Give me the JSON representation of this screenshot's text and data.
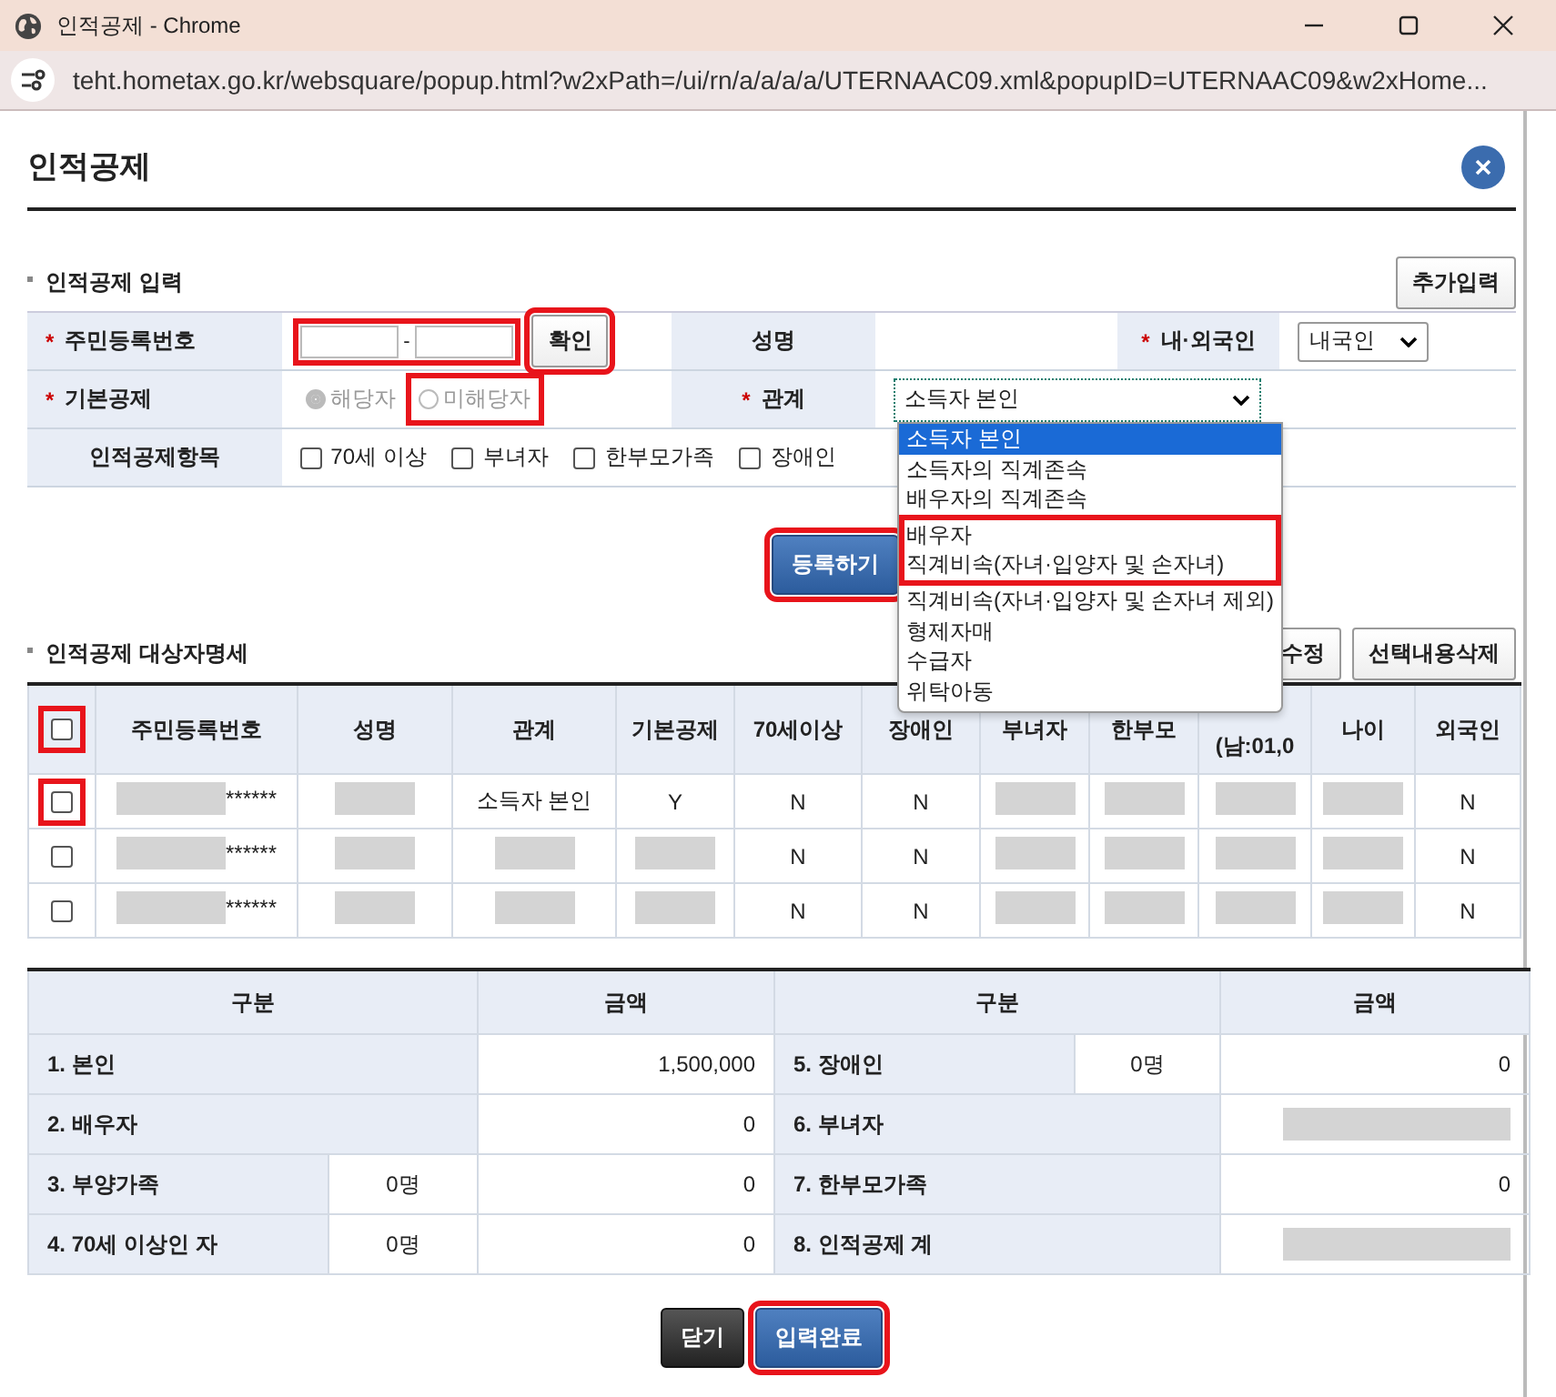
{
  "window": {
    "title": "인적공제 - Chrome",
    "url": "teht.hometax.go.kr/websquare/popup.html?w2xPath=/ui/rn/a/a/a/a/UTERNAAC09.xml&popupID=UTERNAAC09&w2xHome..."
  },
  "dialog": {
    "title": "인적공제"
  },
  "input_section": {
    "title": "인적공제 입력",
    "add_button": "추가입력",
    "id_label": "주민등록번호",
    "required_marks": [
      "*",
      "*",
      "*",
      "*"
    ],
    "id_separator": "-",
    "id_highlighted": true,
    "confirm_button": {
      "label": "확인",
      "highlighted": true
    },
    "name_label": "성명",
    "nationality_label": "내·외국인",
    "nationality_value": "내국인",
    "basic_label": "기본공제",
    "basic_options": [
      {
        "label": "해당자",
        "selected": true,
        "disabled": true,
        "highlighted": false
      },
      {
        "label": "미해당자",
        "selected": false,
        "disabled": true,
        "highlighted": true
      }
    ],
    "relation_label": "관계",
    "relation_value": "소득자 본인",
    "items_label": "인적공제항목",
    "items": [
      {
        "label": "70세 이상",
        "checked": false
      },
      {
        "label": "부녀자",
        "checked": false
      },
      {
        "label": "한부모가족",
        "checked": false
      },
      {
        "label": "장애인",
        "checked": false
      }
    ],
    "register_button": {
      "label": "등록하기",
      "highlighted": true
    }
  },
  "relation_dropdown": [
    {
      "label": "소득자 본인",
      "selected": true,
      "highlighted": false
    },
    {
      "label": "소득자의 직계존속",
      "selected": false,
      "highlighted": false
    },
    {
      "label": "배우자의 직계존속",
      "selected": false,
      "highlighted": false
    },
    {
      "label": "배우자",
      "selected": false,
      "highlighted": true
    },
    {
      "label": "직계비속(자녀·입양자 및 손자녀)",
      "selected": false,
      "highlighted": true
    },
    {
      "label": "직계비속(자녀·입양자 및 손자녀 제외)",
      "selected": false,
      "highlighted": false
    },
    {
      "label": "형제자매",
      "selected": false,
      "highlighted": false
    },
    {
      "label": "수급자",
      "selected": false,
      "highlighted": false
    },
    {
      "label": "위탁아동",
      "selected": false,
      "highlighted": false
    }
  ],
  "list_section": {
    "title": "인적공제 대상자명세",
    "buttons": [
      "수정",
      "선택내용삭제"
    ],
    "header_checkbox": {
      "checked": false,
      "highlighted": true
    },
    "columns": [
      "주민등록번호",
      "성명",
      "관계",
      "기본공제",
      "70세이상",
      "장애인",
      "부녀자",
      "한부모",
      "(남:01,0",
      "나이",
      "외국인"
    ],
    "rows": [
      {
        "checked": false,
        "highlighted": true,
        "cells": [
          {
            "text": "******",
            "redacted": true
          },
          {
            "redacted": true
          },
          {
            "text": "소득자 본인"
          },
          {
            "text": "Y"
          },
          {
            "text": "N"
          },
          {
            "text": "N"
          },
          {
            "redacted": true
          },
          {
            "redacted": true
          },
          {
            "redacted": true
          },
          {
            "redacted": true
          },
          {
            "text": "N"
          }
        ]
      },
      {
        "checked": false,
        "highlighted": false,
        "cells": [
          {
            "text": "******",
            "redacted": true
          },
          {
            "redacted": true
          },
          {
            "redacted": true
          },
          {
            "redacted": true
          },
          {
            "text": "N"
          },
          {
            "text": "N"
          },
          {
            "redacted": true
          },
          {
            "redacted": true
          },
          {
            "redacted": true
          },
          {
            "redacted": true
          },
          {
            "text": "N"
          }
        ]
      },
      {
        "checked": false,
        "highlighted": false,
        "cells": [
          {
            "text": "******",
            "redacted": true
          },
          {
            "redacted": true
          },
          {
            "redacted": true
          },
          {
            "redacted": true
          },
          {
            "text": "N"
          },
          {
            "text": "N"
          },
          {
            "redacted": true
          },
          {
            "redacted": true
          },
          {
            "redacted": true
          },
          {
            "redacted": true
          },
          {
            "text": "N"
          }
        ]
      }
    ]
  },
  "summary": {
    "columns": [
      "구분",
      "금액",
      "구분",
      "금액"
    ],
    "rows": [
      {
        "left": {
          "label": "1. 본인",
          "amount": "1,500,000"
        },
        "right": {
          "label": "5. 장애인",
          "count": "0명",
          "amount": "0"
        }
      },
      {
        "left": {
          "label": "2. 배우자",
          "amount": "0"
        },
        "right": {
          "label": "6. 부녀자",
          "redacted": true
        }
      },
      {
        "left": {
          "label": "3. 부양가족",
          "count": "0명",
          "amount": "0"
        },
        "right": {
          "label": "7. 한부모가족",
          "amount": "0"
        }
      },
      {
        "left": {
          "label": "4. 70세 이상인 자",
          "count": "0명",
          "amount": "0"
        },
        "right": {
          "label": "8. 인적공제 계",
          "redacted": true
        }
      }
    ]
  },
  "footer": {
    "close_button": "닫기",
    "done_button": {
      "label": "입력완료",
      "highlighted": true
    }
  }
}
